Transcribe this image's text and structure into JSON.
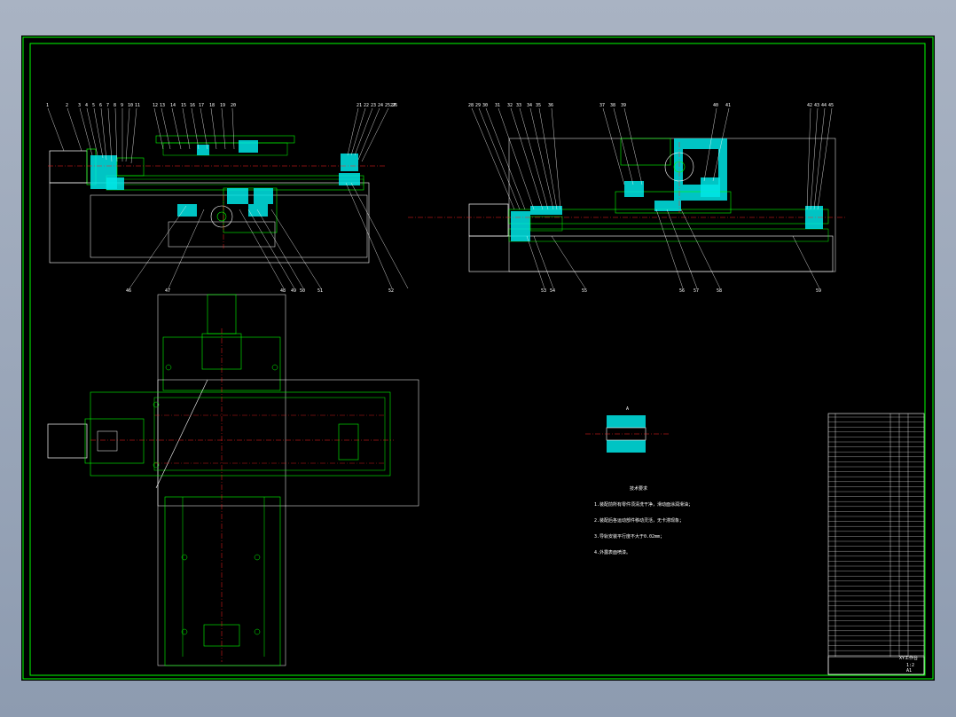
{
  "colors": {
    "background": "#000000",
    "frame": "#00ff00",
    "section_hatch": "#00e6e6",
    "centerline": "#ff2020",
    "outline": "#ffffff",
    "detail": "#00ff00"
  },
  "drawing": {
    "callouts_top_left": [
      "1",
      "2",
      "3",
      "4",
      "5",
      "6",
      "7",
      "8",
      "9",
      "10",
      "11",
      "12",
      "13",
      "14",
      "15",
      "16",
      "17",
      "18",
      "19",
      "20",
      "21",
      "22",
      "23",
      "24",
      "25",
      "26",
      "27"
    ],
    "callouts_top_right": [
      "28",
      "29",
      "30",
      "31",
      "32",
      "33",
      "34",
      "35",
      "36",
      "37",
      "38",
      "39",
      "40",
      "41",
      "42",
      "43",
      "44",
      "45"
    ],
    "callouts_bottom_left": [
      "46",
      "47",
      "48",
      "49",
      "50",
      "51",
      "52"
    ],
    "callouts_bottom_right": [
      "53",
      "54",
      "55",
      "56",
      "57",
      "58",
      "59"
    ],
    "detail_label": "A",
    "notes": {
      "title": "技术要求",
      "lines": [
        "1.装配前所有零件须清洗干净，滑动面涂润滑油；",
        "2.装配后各运动部件移动灵活，无卡滞现象；",
        "3.导轨安装平行度不大于0.02mm；",
        "4.外露表面喷漆。"
      ]
    },
    "title_block": {
      "name": "XY工作台",
      "scale": "1:2",
      "sheet": "A1"
    }
  }
}
